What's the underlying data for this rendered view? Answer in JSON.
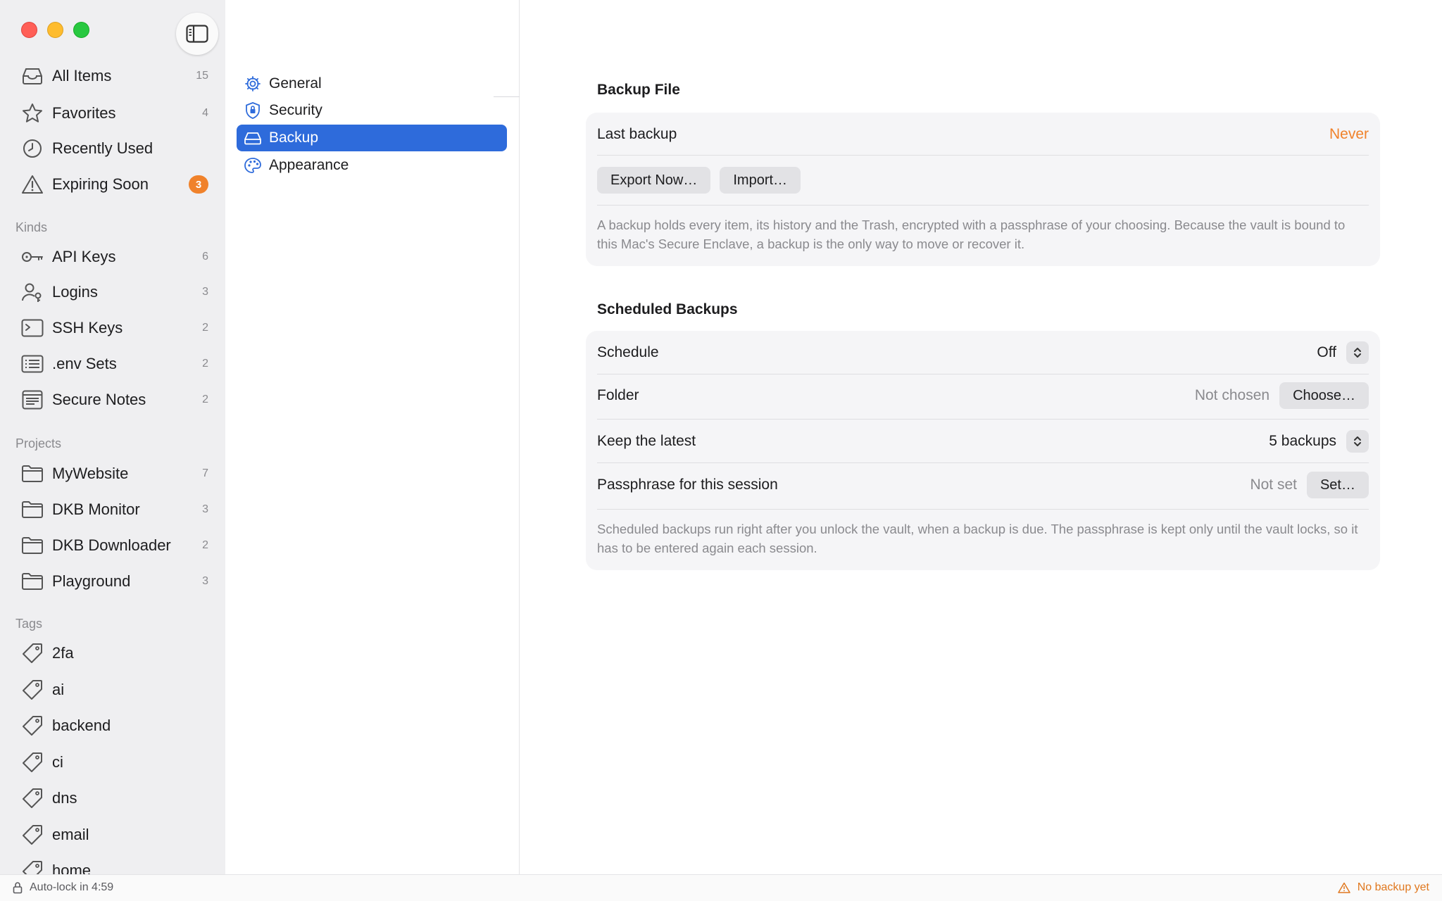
{
  "sidebar": {
    "main_items": [
      {
        "label": "All Items",
        "count": "15",
        "icon": "tray-icon"
      },
      {
        "label": "Favorites",
        "count": "4",
        "icon": "star-icon"
      },
      {
        "label": "Recently Used",
        "count": "",
        "icon": "clock-icon"
      },
      {
        "label": "Expiring Soon",
        "badge": "3",
        "icon": "warning-icon"
      }
    ],
    "kinds_header": "Kinds",
    "kinds": [
      {
        "label": "API Keys",
        "count": "6",
        "icon": "key-icon"
      },
      {
        "label": "Logins",
        "count": "3",
        "icon": "person-key-icon"
      },
      {
        "label": "SSH Keys",
        "count": "2",
        "icon": "terminal-icon"
      },
      {
        "label": ".env Sets",
        "count": "2",
        "icon": "list-icon"
      },
      {
        "label": "Secure Notes",
        "count": "2",
        "icon": "note-icon"
      }
    ],
    "projects_header": "Projects",
    "projects": [
      {
        "label": "MyWebsite",
        "count": "7",
        "icon": "folder-icon"
      },
      {
        "label": "DKB Monitor",
        "count": "3",
        "icon": "folder-icon"
      },
      {
        "label": "DKB Downloader",
        "count": "2",
        "icon": "folder-icon"
      },
      {
        "label": "Playground",
        "count": "3",
        "icon": "folder-icon"
      }
    ],
    "tags_header": "Tags",
    "tags": [
      "2fa",
      "ai",
      "backend",
      "ci",
      "dns",
      "email",
      "home"
    ]
  },
  "status": {
    "autolock": "Auto-lock in 4:59",
    "backup_warning": "No backup yet"
  },
  "settings_nav": [
    {
      "label": "General",
      "icon": "gear-icon",
      "active": false
    },
    {
      "label": "Security",
      "icon": "shield-icon",
      "active": false
    },
    {
      "label": "Backup",
      "icon": "drive-icon",
      "active": true
    },
    {
      "label": "Appearance",
      "icon": "palette-icon",
      "active": false
    }
  ],
  "backup_file": {
    "title": "Backup File",
    "last_backup_label": "Last backup",
    "last_backup_value": "Never",
    "export_button": "Export Now…",
    "import_button": "Import…",
    "note": "A backup holds every item, its history and the Trash, encrypted with a passphrase of your choosing. Because the vault is bound to this Mac's Secure Enclave, a backup is the only way to move or recover it."
  },
  "scheduled": {
    "title": "Scheduled Backups",
    "schedule_label": "Schedule",
    "schedule_value": "Off",
    "folder_label": "Folder",
    "folder_value": "Not chosen",
    "folder_button": "Choose…",
    "keep_label": "Keep the latest",
    "keep_value": "5 backups",
    "passphrase_label": "Passphrase for this session",
    "passphrase_value": "Not set",
    "passphrase_button": "Set…",
    "note": "Scheduled backups run right after you unlock the vault, when a backup is due. The passphrase is kept only until the vault locks, so it has to be entered again each session."
  },
  "colors": {
    "accent": "#2e6bdb",
    "warning": "#f0822b",
    "sidebar_bg": "#efeff1"
  }
}
